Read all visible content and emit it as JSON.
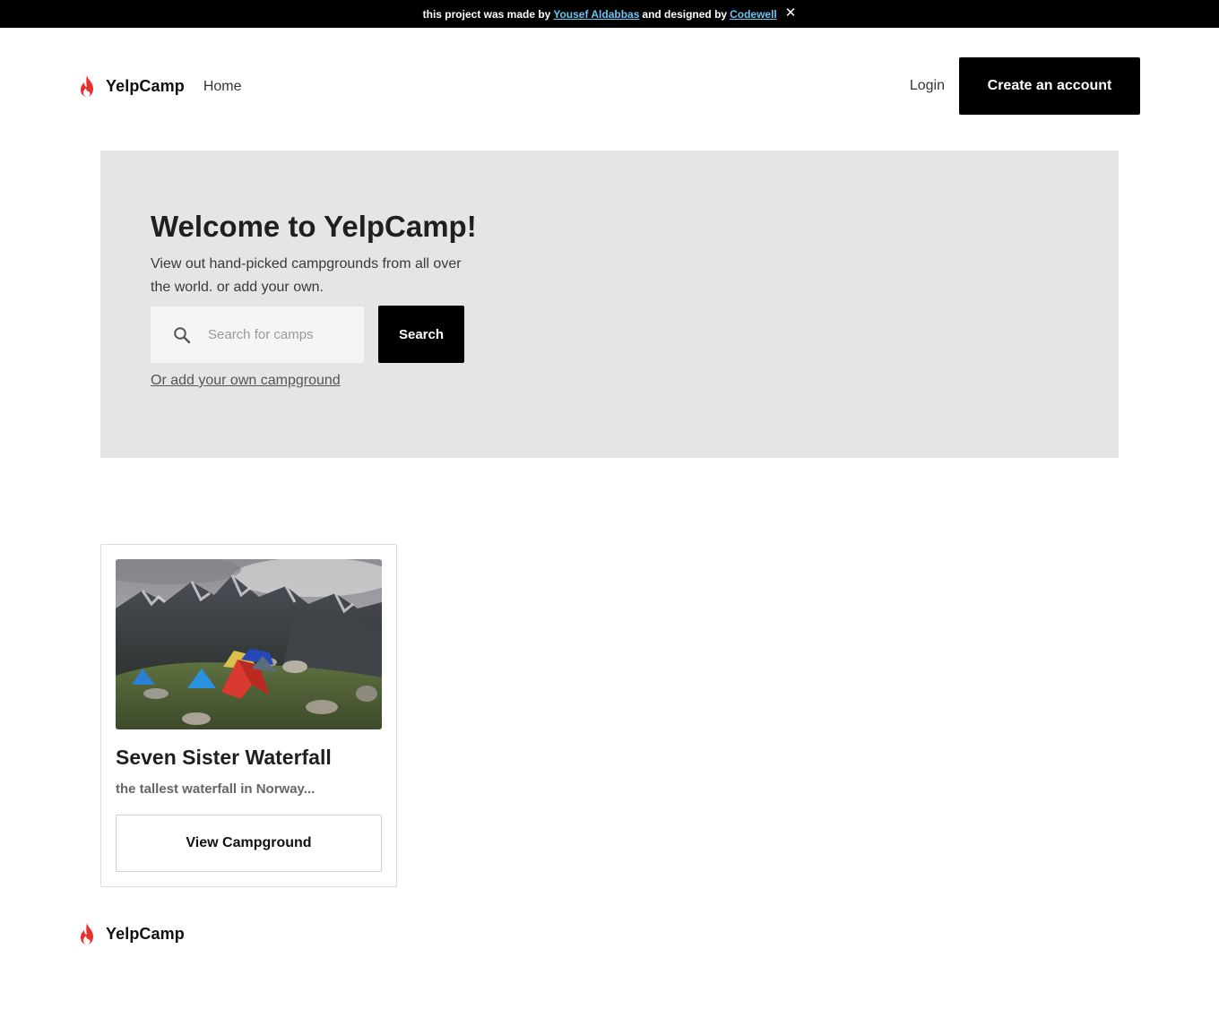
{
  "banner": {
    "prefix": "this project was made by",
    "author_link": "Yousef Aldabbas",
    "middle": "and designed by",
    "designer_link": "Codewell",
    "close_icon": "close-icon"
  },
  "nav": {
    "brand": "YelpCamp",
    "home": "Home",
    "login": "Login",
    "create_account": "Create an account"
  },
  "hero": {
    "title": "Welcome to YelpCamp!",
    "subtitle": "View out hand-picked campgrounds from all over the world. or add your own.",
    "search_placeholder": "Search for camps",
    "search_button": "Search",
    "add_link": "Or add your own campground"
  },
  "campgrounds": [
    {
      "title": "Seven Sister Waterfall",
      "description": "the tallest waterfall in Norway...",
      "button": "View Campground"
    }
  ],
  "footer": {
    "brand": "YelpCamp"
  },
  "colors": {
    "accent": "#000000",
    "flame": "#e8312f",
    "hero_bg": "#e5e5e5",
    "link": "#6cc4f0"
  }
}
